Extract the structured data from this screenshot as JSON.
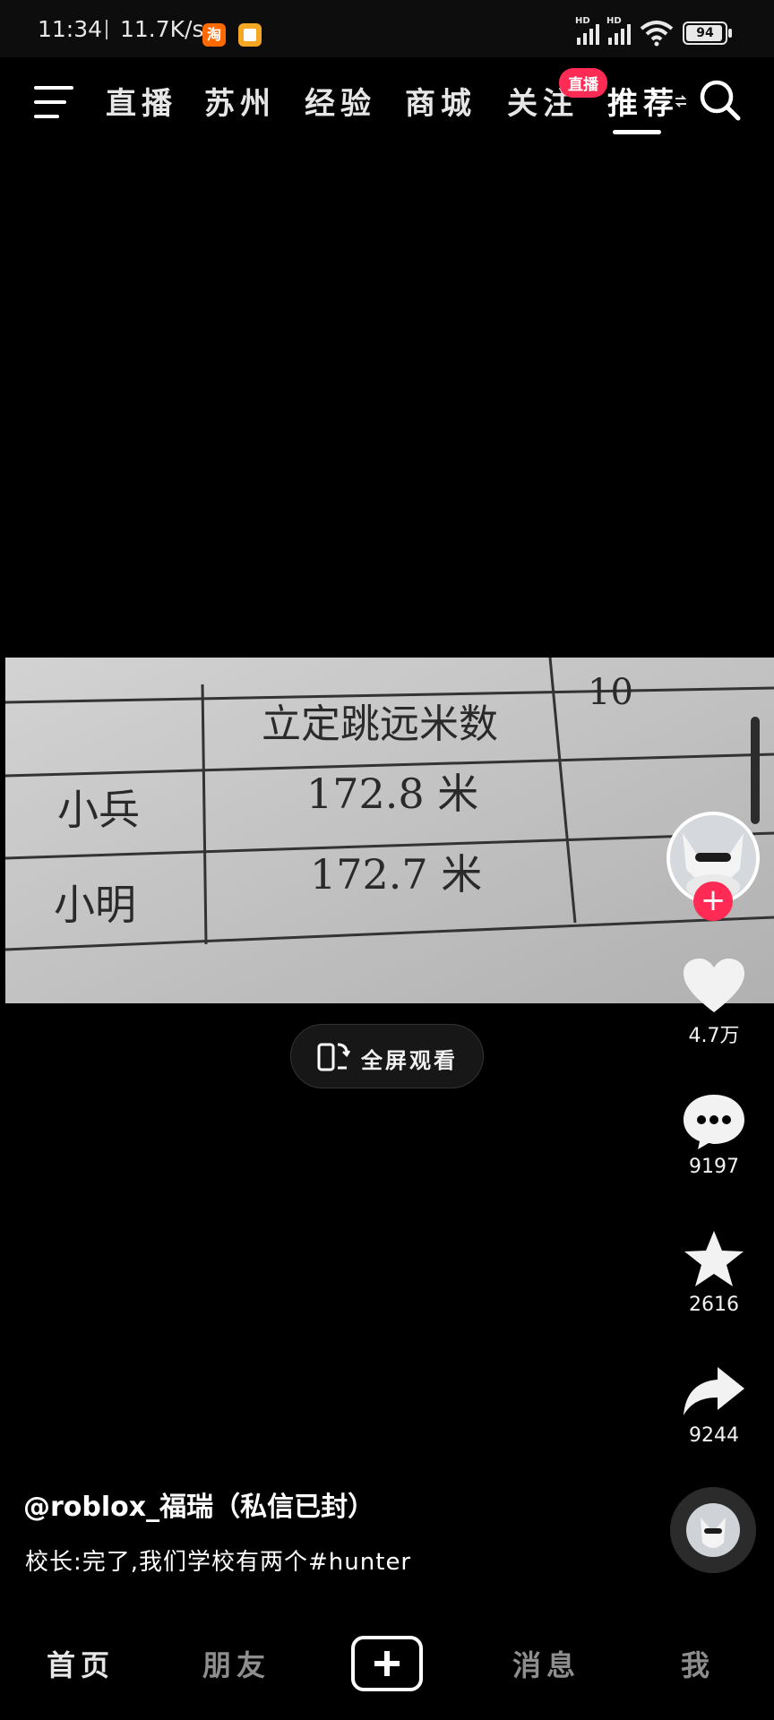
{
  "status_bar": {
    "time": "11:34",
    "net_speed": "11.7K/s",
    "app_badges": [
      {
        "name": "taobao-icon",
        "text": "淘",
        "color": "#ff6a00"
      },
      {
        "name": "notes-app-icon",
        "text": "",
        "color": "#f5a623"
      }
    ],
    "signal_label": "HD",
    "battery": "94"
  },
  "top_nav": {
    "tabs": [
      "直播",
      "苏州",
      "经验",
      "商城",
      "关注",
      "推荐"
    ],
    "active_tab": "推荐",
    "live_badge": "直播",
    "accent_color": "#ff2b55"
  },
  "video": {
    "table": {
      "header": "立定跳远米数",
      "side_digits": "10",
      "rows": [
        {
          "name": "小兵",
          "value": "172.8 米"
        },
        {
          "name": "小明",
          "value": "172.7 米"
        }
      ]
    },
    "fullscreen_label": "全屏观看"
  },
  "actions": {
    "likes": "4.7万",
    "comments": "9197",
    "favorites": "2616",
    "shares": "9244"
  },
  "post": {
    "author": "@roblox_福瑞（私信已封）",
    "caption": "校长:完了,我们学校有两个#hunter"
  },
  "bottom_nav": {
    "items": [
      "首页",
      "朋友",
      "消息",
      "我"
    ]
  }
}
